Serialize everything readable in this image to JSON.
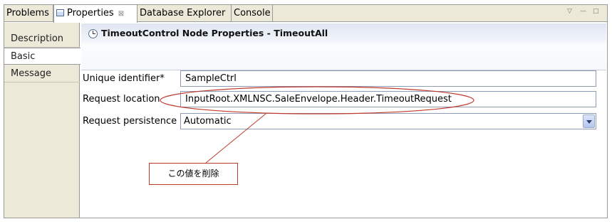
{
  "tabs": [
    {
      "label": "Problems",
      "active": false
    },
    {
      "label": "Properties",
      "active": true,
      "close": "⊠"
    },
    {
      "label": "Database Explorer",
      "active": false
    },
    {
      "label": "Console",
      "active": false
    }
  ],
  "view_controls": {
    "menu": "▽",
    "minimize": "—",
    "maximize": "□"
  },
  "sidebar": {
    "items": [
      {
        "label": "Description",
        "active": false
      },
      {
        "label": "Basic",
        "active": true
      },
      {
        "label": "Message",
        "active": false
      }
    ]
  },
  "header": {
    "icon": "clock-icon",
    "title": "TimeoutControl Node Properties - TimeoutAll"
  },
  "fields": {
    "unique_identifier": {
      "label": "Unique identifier*",
      "value": "SampleCtrl"
    },
    "request_location": {
      "label": "Request location",
      "value": "InputRoot.XMLNSC.SaleEnvelope.Header.TimeoutRequest"
    },
    "request_persistence": {
      "label": "Request persistence",
      "value": "Automatic"
    }
  },
  "annotation": {
    "callout_text": "この値を削除",
    "color": "#c0392b"
  },
  "colors": {
    "chrome": "#ece9d8",
    "border": "#9a9a9a",
    "header_gradient": "#dfe6f2"
  }
}
